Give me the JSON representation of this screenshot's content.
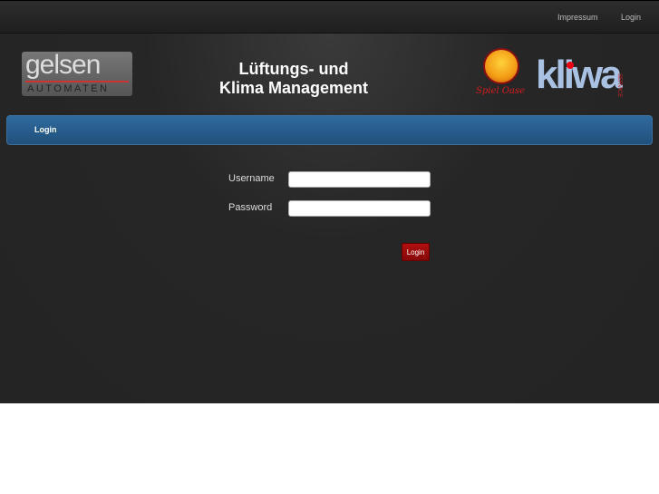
{
  "topnav": {
    "impressum": "Impressum",
    "login": "Login"
  },
  "header": {
    "logo_left": {
      "word": "gelsen",
      "sub": "AUTOMATEN"
    },
    "title_line1": "Lüftungs- und",
    "title_line2": "Klima Management",
    "logo_right1": "Spiel Oase",
    "logo_right2": {
      "word": "kliwa",
      "sub": "SERVICE"
    }
  },
  "bar": {
    "title": "Login"
  },
  "form": {
    "username_label": "Username",
    "username_value": "",
    "password_label": "Password",
    "password_value": "",
    "submit_label": "Login"
  }
}
